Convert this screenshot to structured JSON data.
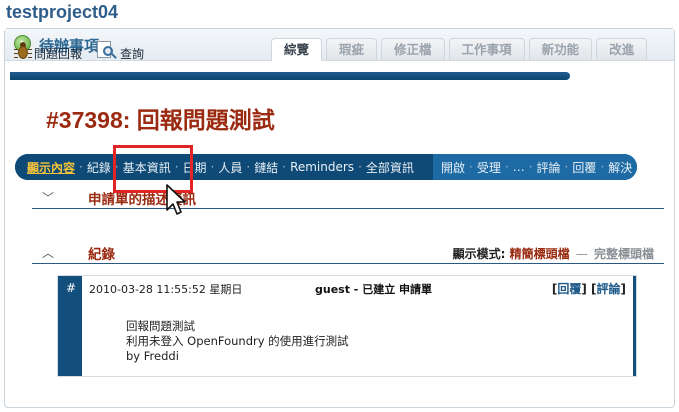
{
  "project": {
    "title": "testproject04"
  },
  "header": {
    "section_title": "待辦事項"
  },
  "tabs": [
    {
      "label": "綜覽",
      "active": true
    },
    {
      "label": "瑕疵",
      "active": false
    },
    {
      "label": "修正檔",
      "active": false
    },
    {
      "label": "工作事項",
      "active": false
    },
    {
      "label": "新功能",
      "active": false
    },
    {
      "label": "改進",
      "active": false
    }
  ],
  "toolbar": {
    "report_label": "問題回報",
    "query_label": "查詢"
  },
  "issue": {
    "title": "#37398: 回報問題測試"
  },
  "nav": {
    "left": [
      "顯示內容",
      "紀錄",
      "基本資訊",
      "日期",
      "人員",
      "鏈結",
      "Reminders",
      "全部資訊"
    ],
    "right": [
      "開啟",
      "受理",
      "…",
      "評論",
      "回覆",
      "解決"
    ]
  },
  "sections": {
    "request_description": "申請單的描述資訊",
    "log": "紀錄",
    "display_mode_label": "顯示模式:",
    "mode_selected": "精簡標頭檔",
    "mode_dash": "—",
    "mode_other": "完整標頭檔"
  },
  "note": {
    "hash": "#",
    "date": "2010-03-28 11:55:52 星期日",
    "author": "guest - 已建立 申請單",
    "reply": "回覆",
    "comment": "評論",
    "body": [
      "回報問題測試",
      "利用未登入 OpenFoundry 的使用進行測試",
      "by Freddi"
    ]
  },
  "colors": {
    "accent": "#0e4a75",
    "title_red": "#9a2a10",
    "highlight": "#f6c33a",
    "focus_box": "#e32424"
  }
}
